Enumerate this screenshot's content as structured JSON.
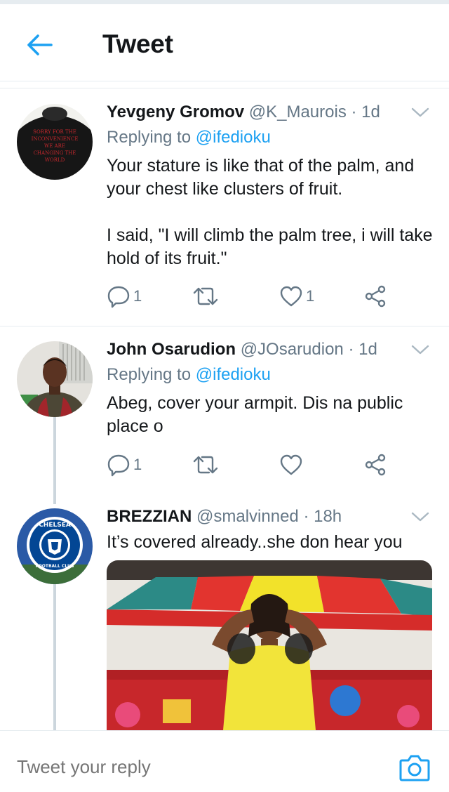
{
  "header": {
    "title": "Tweet"
  },
  "tweets": [
    {
      "name": "Yevgeny Gromov",
      "handle": "@K_Maurois",
      "time": "· 1d",
      "replying_prefix": "Replying to",
      "replying_to": "@ifedioku",
      "paragraphs": [
        "Your stature is like that of the palm, and your chest like clusters of fruit.",
        "I said, \"I will climb the palm tree, i will take hold of its fruit.\""
      ],
      "replies": "1",
      "likes": "1",
      "avatar_shirt_text": [
        "SORRY FOR THE",
        "INCONVENIENCE",
        "WE ARE",
        "CHANGING THE",
        "WORLD"
      ]
    },
    {
      "name": "John Osarudion",
      "handle": "@JOsarudion",
      "time": "· 1d",
      "replying_prefix": "Replying to",
      "replying_to": "@ifedioku",
      "paragraphs": [
        "Abeg, cover your armpit. Dis na public place o"
      ],
      "replies": "1"
    },
    {
      "name": "BREZZIAN",
      "handle": "@smalvinned",
      "time": "· 18h",
      "paragraphs": [
        "It’s covered already..she don hear you"
      ],
      "avatar_badge_text": [
        "CHELSEA",
        "FOOTBALL CLUB"
      ]
    }
  ],
  "reply_bar": {
    "placeholder": "Tweet your reply"
  },
  "colors": {
    "accent": "#1da1f2",
    "text": "#14171a",
    "secondary": "#657786",
    "border": "#e6ecf0",
    "thread": "#ccd6dd"
  },
  "icons": [
    "back-arrow-icon",
    "chevron-down-icon",
    "reply-icon",
    "retweet-icon",
    "like-icon",
    "share-icon",
    "camera-icon"
  ]
}
